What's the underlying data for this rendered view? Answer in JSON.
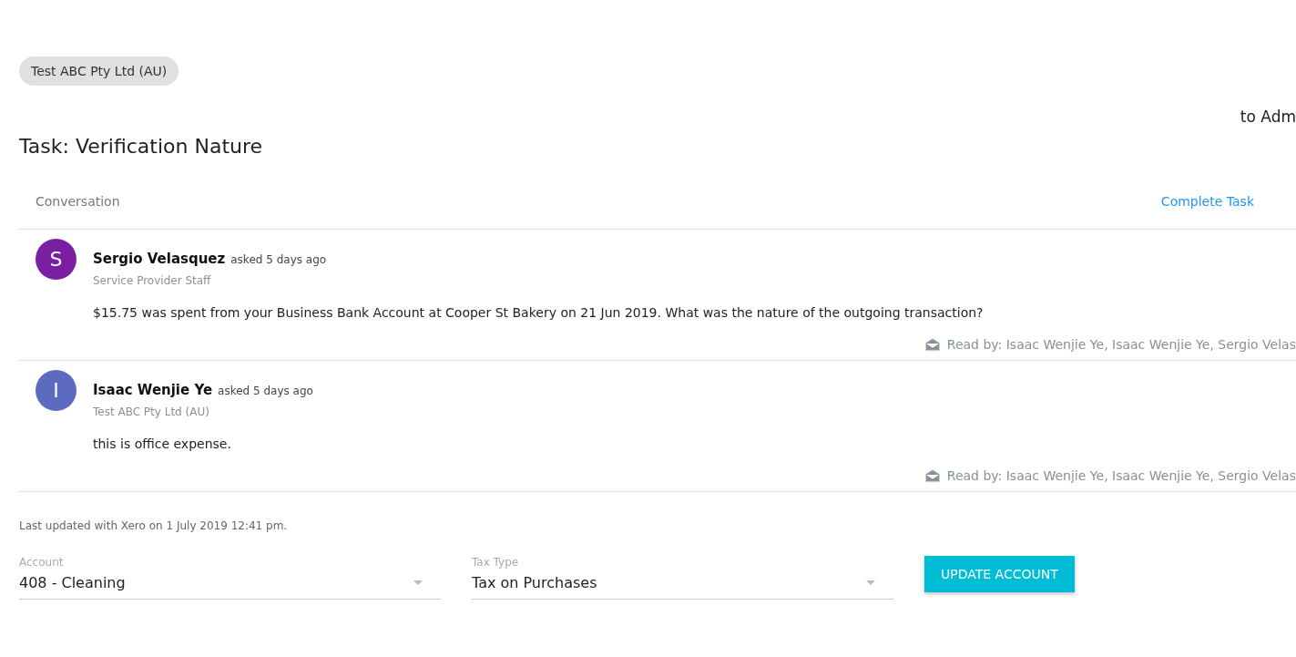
{
  "org_chip": "Test ABC Pty Ltd (AU)",
  "assignee": "to Adm",
  "task_title": "Task: Verification Nature",
  "conversation": {
    "label": "Conversation",
    "action": "Complete Task",
    "messages": [
      {
        "initial": "S",
        "color": "#7b1fa2",
        "author": "Sergio Velasquez",
        "meta": "asked 5 days ago",
        "role": "Service Provider Staff",
        "body": "$15.75 was spent from your Business Bank Account at Cooper St Bakery on 21 Jun 2019. What was the nature of the outgoing transaction?",
        "read_by": "Read by: Isaac Wenjie Ye, Isaac Wenjie Ye, Sergio Velas"
      },
      {
        "initial": "I",
        "color": "#5c6bc0",
        "author": "Isaac Wenjie Ye",
        "meta": "asked 5 days ago",
        "role": "Test ABC Pty Ltd (AU)",
        "body": "this is office expense.",
        "read_by": "Read by: Isaac Wenjie Ye, Isaac Wenjie Ye, Sergio Velas"
      }
    ]
  },
  "last_updated": "Last updated with Xero on 1 July 2019 12:41 pm.",
  "fields": [
    {
      "label": "Account",
      "value": "408 - Cleaning"
    },
    {
      "label": "Tax Type",
      "value": "Tax on Purchases"
    }
  ],
  "update_button": "UPDATE ACCOUNT"
}
